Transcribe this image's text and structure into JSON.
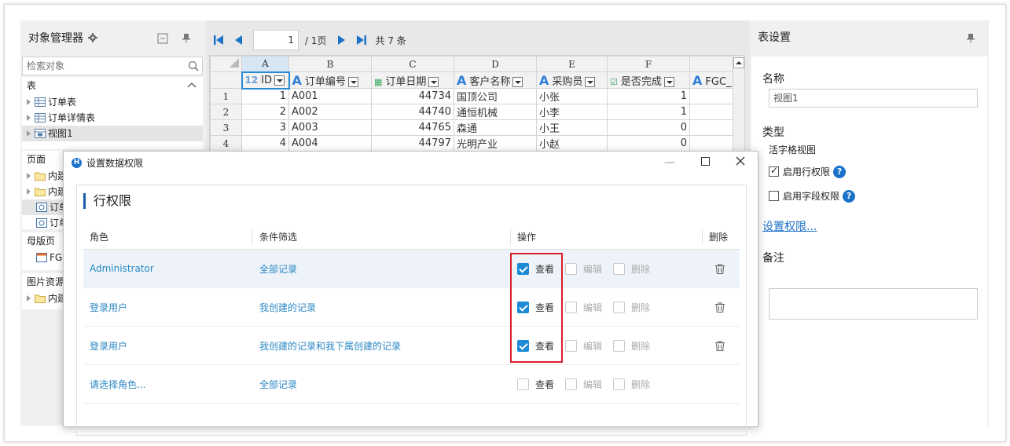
{
  "object_manager": {
    "title": "对象管理器",
    "search_placeholder": "检索对象",
    "tables_section": "表",
    "tables": [
      "订单表",
      "订单详情表",
      "视图1"
    ],
    "pages_section": "页面",
    "pages": [
      "内建",
      "内建",
      "订单",
      "订单"
    ],
    "master_section": "母版页",
    "masters": [
      "FG"
    ],
    "images_section": "图片资源",
    "images": [
      "内建"
    ]
  },
  "navigator": {
    "page_value": "1",
    "page_total": "/ 1页",
    "record_count": "共 7 条"
  },
  "grid": {
    "column_letters": [
      "A",
      "B",
      "C",
      "D",
      "E",
      "F",
      ""
    ],
    "fields": [
      {
        "icon": "12",
        "name": "ID"
      },
      {
        "icon": "A",
        "name": "订单编号"
      },
      {
        "icon": "date",
        "name": "订单日期"
      },
      {
        "icon": "A",
        "name": "客户名称"
      },
      {
        "icon": "A",
        "name": "采购员"
      },
      {
        "icon": "bool",
        "name": "是否完成"
      },
      {
        "icon": "A",
        "name": "FGC_"
      }
    ],
    "rows": [
      {
        "n": "1",
        "cells": [
          "1",
          "A001",
          "44734",
          "国顶公司",
          "小张",
          "1",
          ""
        ]
      },
      {
        "n": "2",
        "cells": [
          "2",
          "A002",
          "44740",
          "通恒机械",
          "小李",
          "1",
          ""
        ]
      },
      {
        "n": "3",
        "cells": [
          "3",
          "A003",
          "44765",
          "森通",
          "小王",
          "0",
          ""
        ]
      },
      {
        "n": "4",
        "cells": [
          "4",
          "A004",
          "44797",
          "光明产业",
          "小赵",
          "0",
          ""
        ]
      }
    ]
  },
  "table_settings": {
    "title": "表设置",
    "name_label": "名称",
    "name_value": "视图1",
    "type_label": "类型",
    "type_value": "活字格视图",
    "row_perm_label": "启用行权限",
    "field_perm_label": "启用字段权限",
    "set_perm_link": "设置权限...",
    "notes_label": "备注"
  },
  "dialog": {
    "title": "设置数据权限",
    "section_title": "行权限",
    "headers": {
      "role": "角色",
      "condition": "条件筛选",
      "ops": "操作",
      "delete": "删除"
    },
    "op_labels": {
      "view": "查看",
      "edit": "编辑",
      "delete": "删除"
    },
    "rows": [
      {
        "role": "Administrator",
        "condition": "全部记录",
        "view": true,
        "edit": false,
        "del": false
      },
      {
        "role": "登录用户",
        "condition": "我创建的记录",
        "view": true,
        "edit": false,
        "del": false
      },
      {
        "role": "登录用户",
        "condition": "我创建的记录和我下属创建的记录",
        "view": true,
        "edit": false,
        "del": false
      },
      {
        "role": "请选择角色...",
        "condition": "全部记录",
        "view": false,
        "edit": false,
        "del": false
      }
    ]
  },
  "colors": {
    "accent": "#1d8ad6",
    "link": "#2a88c4",
    "highlight_box": "#d9202a"
  }
}
